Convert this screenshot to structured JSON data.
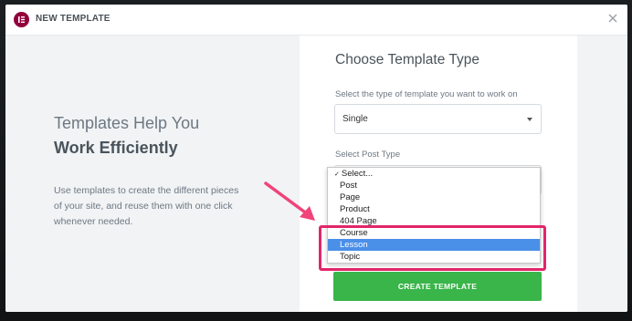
{
  "header": {
    "title": "NEW TEMPLATE",
    "logo_icon": "elementor-logo-icon",
    "close_icon": "close-icon"
  },
  "intro": {
    "title_line1": "Templates Help You",
    "title_line2": "Work Efficiently",
    "description": "Use templates to create the different pieces of your site, and reuse them with one click whenever needed."
  },
  "form": {
    "title": "Choose Template Type",
    "template_type_label": "Select the type of template you want to work on",
    "template_type_value": "Single",
    "post_type_label": "Select Post Type",
    "post_type_options": [
      {
        "label": "Select...",
        "checked": true,
        "selected": false
      },
      {
        "label": "Post",
        "checked": false,
        "selected": false
      },
      {
        "label": "Page",
        "checked": false,
        "selected": false
      },
      {
        "label": "Product",
        "checked": false,
        "selected": false
      },
      {
        "label": "404 Page",
        "checked": false,
        "selected": false
      },
      {
        "label": "Course",
        "checked": false,
        "selected": false
      },
      {
        "label": "Lesson",
        "checked": false,
        "selected": true
      },
      {
        "label": "Topic",
        "checked": false,
        "selected": false
      }
    ],
    "create_button": "CREATE TEMPLATE"
  },
  "colors": {
    "brand": "#92003b",
    "accent_button": "#39b54a",
    "highlight": "#e2256a",
    "option_selected": "#4a8fe8"
  }
}
